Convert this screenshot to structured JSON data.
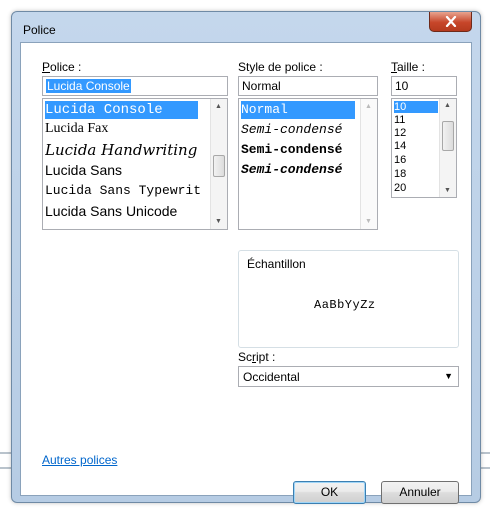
{
  "window": {
    "title": "Police"
  },
  "font": {
    "label_prefix": "",
    "label_accel": "P",
    "label_rest": "olice :",
    "value": "Lucida Console",
    "items": [
      {
        "label": "Lucida Console",
        "selected": true
      },
      {
        "label": "Lucida Fax",
        "selected": false
      },
      {
        "label": "Lucida Handwriting",
        "selected": false
      },
      {
        "label": "Lucida Sans",
        "selected": false
      },
      {
        "label": "Lucida Sans Typewriter",
        "selected": false
      },
      {
        "label": "Lucida Sans Unicode",
        "selected": false
      }
    ]
  },
  "style": {
    "label": "Style de police :",
    "value": "Normal",
    "items": [
      {
        "label": "Normal",
        "selected": true
      },
      {
        "label": "Semi-condensé",
        "selected": false
      },
      {
        "label": "Semi-condensé",
        "selected": false
      },
      {
        "label": "Semi-condensé",
        "selected": false
      }
    ]
  },
  "size": {
    "label_accel": "T",
    "label_rest": "aille :",
    "value": "10",
    "items": [
      {
        "label": "10",
        "selected": true
      },
      {
        "label": "11",
        "selected": false
      },
      {
        "label": "12",
        "selected": false
      },
      {
        "label": "14",
        "selected": false
      },
      {
        "label": "16",
        "selected": false
      },
      {
        "label": "18",
        "selected": false
      },
      {
        "label": "20",
        "selected": false
      }
    ]
  },
  "sample": {
    "label": "Échantillon",
    "text": "AaBbYyZz"
  },
  "script": {
    "label_prefix": "Sc",
    "label_accel": "r",
    "label_rest": "ipt :",
    "value": "Occidental"
  },
  "links": {
    "more_fonts": "Autres polices"
  },
  "buttons": {
    "ok": "OK",
    "cancel": "Annuler"
  }
}
